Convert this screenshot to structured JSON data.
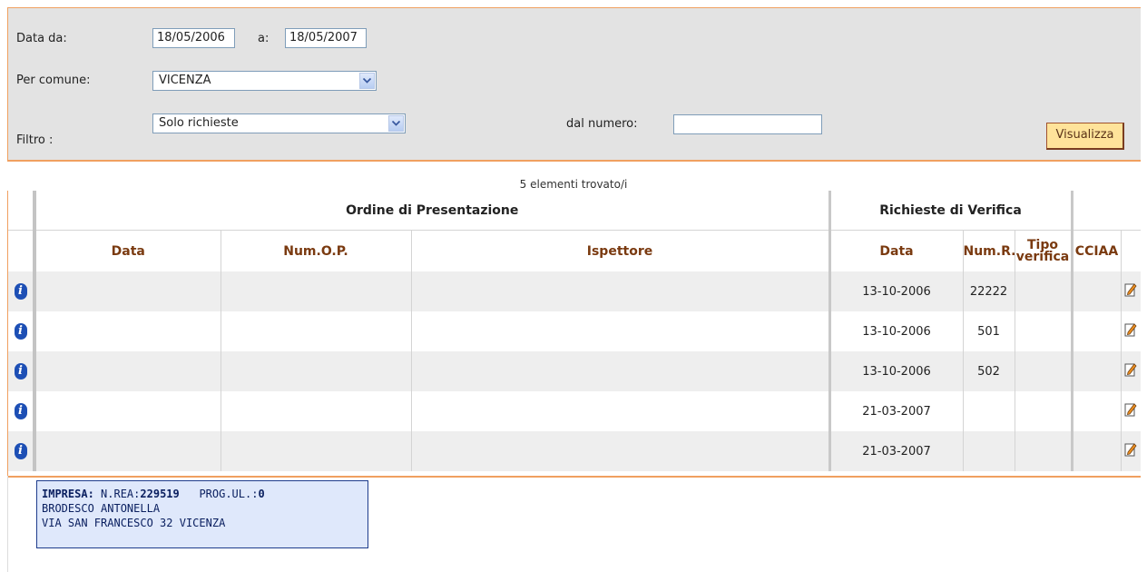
{
  "filters": {
    "date_from_label": "Data da:",
    "date_from_value": "18/05/2006",
    "date_to_label": "a:",
    "date_to_value": "18/05/2007",
    "comune_label": "Per comune:",
    "comune_value": "VICENZA",
    "filtro_label": "Filtro :",
    "filtro_value": "Solo richieste",
    "dal_numero_label": "dal numero:",
    "dal_numero_value": "",
    "submit_label": "Visualizza"
  },
  "results": {
    "count_text": "5 elementi trovato/i",
    "group_headers": {
      "ordine": "Ordine di Presentazione",
      "richieste": "Richieste di Verifica"
    },
    "columns": {
      "data": "Data",
      "num_op": "Num.O.P.",
      "ispettore": "Ispettore",
      "data_r": "Data",
      "num_r": "Num.R.",
      "tipo_1": "Tipo",
      "tipo_2": "verifica",
      "cciaa": "CCIAA"
    },
    "rows": [
      {
        "data": "",
        "num_op": "",
        "ispettore": "",
        "data_r": "13-10-2006",
        "num_r": "22222",
        "tipo": "",
        "cciaa": ""
      },
      {
        "data": "",
        "num_op": "",
        "ispettore": "",
        "data_r": "13-10-2006",
        "num_r": "501",
        "tipo": "",
        "cciaa": ""
      },
      {
        "data": "",
        "num_op": "",
        "ispettore": "",
        "data_r": "13-10-2006",
        "num_r": "502",
        "tipo": "",
        "cciaa": ""
      },
      {
        "data": "",
        "num_op": "",
        "ispettore": "",
        "data_r": "21-03-2007",
        "num_r": "",
        "tipo": "",
        "cciaa": ""
      },
      {
        "data": "",
        "num_op": "",
        "ispettore": "",
        "data_r": "21-03-2007",
        "num_r": "",
        "tipo": "",
        "cciaa": ""
      }
    ]
  },
  "tooltip": {
    "impresa_label": "IMPRESA:",
    "rea_label": "N.REA:",
    "rea_value": "229519",
    "prog_label": "PROG.UL.:",
    "prog_value": "0",
    "name": "BRODESCO ANTONELLA",
    "address": "VIA SAN FRANCESCO 32 VICENZA"
  },
  "icons": {
    "info": "info-icon",
    "edit": "edit-icon",
    "dropdown": "chevron-down-icon"
  },
  "colors": {
    "panel_bg": "#e3e3e3",
    "border_accent": "#f0a060",
    "header_text": "#7a3a10",
    "button_bg": "#ffe39a",
    "tooltip_bg": "#dfe8fb"
  }
}
